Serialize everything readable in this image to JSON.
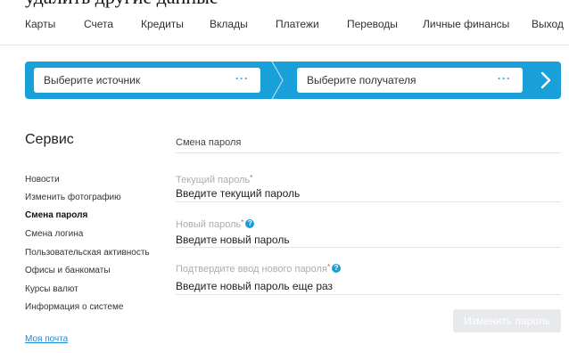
{
  "top_clip_text": "удалить другие данные",
  "nav": {
    "items": [
      "Карты",
      "Счета",
      "Кредиты",
      "Вклады",
      "Платежи",
      "Переводы",
      "Личные финансы",
      "Выход"
    ]
  },
  "transfer": {
    "source_label": "Выберите источник",
    "destination_label": "Выберите получателя",
    "dots": "···"
  },
  "sidebar": {
    "title": "Сервис",
    "items": [
      "Новости",
      "Изменить фотографию",
      "Смена пароля",
      "Смена логина",
      "Пользовательская активность",
      "Офисы и банкоматы",
      "Курсы валют",
      "Информация о системе"
    ],
    "active_index": 2,
    "mail_link": "Моя почта"
  },
  "form": {
    "title": "Смена пароля",
    "current": {
      "label": "Текущий пароль",
      "required": "*",
      "placeholder": "Введите текущий пароль"
    },
    "new": {
      "label": "Новый пароль",
      "required": "*",
      "help": "?",
      "placeholder": "Введите новый пароль"
    },
    "confirm": {
      "label": "Подтвердите ввод нового пароля",
      "required": "*",
      "help": "?",
      "placeholder": "Введите новый пароль еще раз"
    },
    "submit_label": "Изменить пароль"
  },
  "colors": {
    "accent": "#1aa0d9",
    "required": "#e05050",
    "disabled_button": "#e7e9ec"
  }
}
